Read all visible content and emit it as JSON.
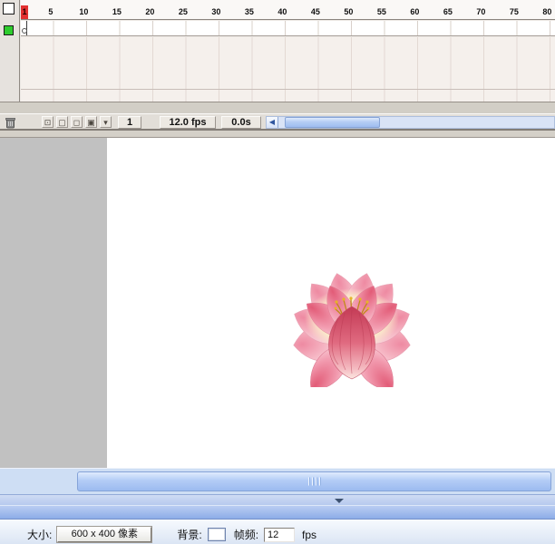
{
  "timeline": {
    "ruler": {
      "current_frame": "1",
      "numbers": [
        "5",
        "10",
        "15",
        "20",
        "25",
        "30",
        "35",
        "40",
        "45",
        "50",
        "55",
        "60",
        "65",
        "70",
        "75",
        "80"
      ]
    },
    "footer": {
      "current_frame": "1",
      "frame_rate": "12.0 fps",
      "elapsed_time": "0.0s",
      "icons": [
        {
          "name": "center-frame",
          "glyph": "⊡"
        },
        {
          "name": "onion-skin",
          "glyph": "▢"
        },
        {
          "name": "onion-skin-outlines",
          "glyph": "◻"
        },
        {
          "name": "edit-multiple-frames",
          "glyph": "▣"
        },
        {
          "name": "modify-onion-markers",
          "glyph": "▾"
        }
      ],
      "scroll_left_arrow": "◀"
    }
  },
  "properties": {
    "size_label": "大小:",
    "size_value": "600 x 400 像素",
    "background_label": "背景:",
    "framerate_label": "帧频:",
    "framerate_value": "12",
    "fps_unit": "fps"
  },
  "colors": {
    "playhead_red": "#e23030",
    "layer_outline_green": "#2ecc2e",
    "workspace_gray": "#c1c1c1",
    "stage_white": "#ffffff",
    "scrollbar_blue": "#9cbbf0"
  }
}
